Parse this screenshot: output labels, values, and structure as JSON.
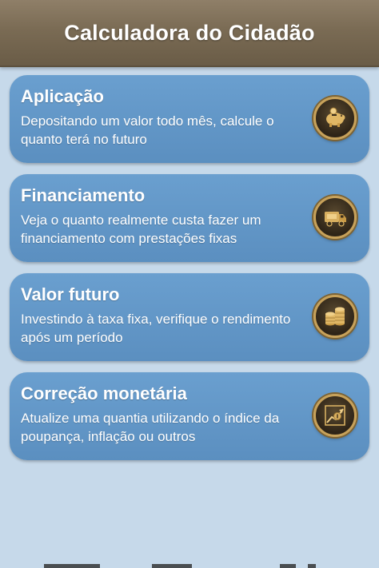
{
  "header": {
    "title": "Calculadora do Cidadão"
  },
  "cards": [
    {
      "title": "Aplicação",
      "description": "Depositando um valor todo mês, calcule o quanto terá no futuro",
      "icon": "piggy-bank-icon"
    },
    {
      "title": "Financiamento",
      "description": "Veja o quanto realmente custa fazer um financiamento com prestações fixas",
      "icon": "truck-icon"
    },
    {
      "title": "Valor futuro",
      "description": "Investindo à taxa fixa, verifique o rendimento após um período",
      "icon": "coins-icon"
    },
    {
      "title": "Correção monetária",
      "description": "Atualize uma quantia utilizando o índice da poupança, inflação ou outros",
      "icon": "chart-growth-icon"
    }
  ],
  "colors": {
    "header": "#7a6b54",
    "background": "#c6d9ea",
    "card": "#6a9fcf",
    "icon_ring": "#c8a25a"
  }
}
